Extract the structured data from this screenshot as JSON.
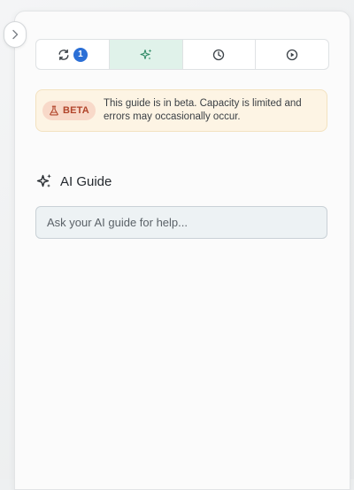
{
  "tabs": [
    {
      "name": "refresh",
      "icon": "refresh-icon",
      "badge": "1"
    },
    {
      "name": "ai-guide",
      "icon": "sparkles-icon",
      "active": true
    },
    {
      "name": "history",
      "icon": "clock-icon"
    },
    {
      "name": "play",
      "icon": "play-circle-icon"
    }
  ],
  "beta": {
    "label": "BETA",
    "message": "This guide is in beta. Capacity is limited and errors may occasionally occur."
  },
  "guide": {
    "title": "AI Guide",
    "placeholder": "Ask your AI guide for help..."
  },
  "colors": {
    "active_tab": "#e0f2ea",
    "badge": "#2b6fd6",
    "beta_bg": "#fdf4e4",
    "beta_pill": "#f8d9c9",
    "beta_text": "#b1442a"
  }
}
